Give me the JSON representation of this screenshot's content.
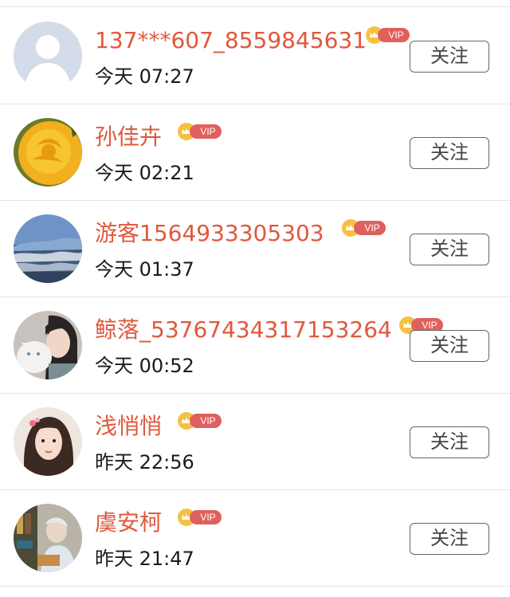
{
  "follow_list": {
    "follow_label": "关注",
    "vip_label": "VIP",
    "items": [
      {
        "name": "137***607_8559845631",
        "time": "今天 07:27",
        "avatar": "default-person-avatar"
      },
      {
        "name": "孙佳卉",
        "time": "今天 02:21",
        "avatar": "yellow-flower-avatar"
      },
      {
        "name": "游客1564933305303",
        "time": "今天 01:37",
        "avatar": "mountain-landscape-avatar"
      },
      {
        "name": "鲸落_53767434317153264",
        "time": "今天 00:52",
        "avatar": "girl-with-cat-avatar"
      },
      {
        "name": "浅悄悄",
        "time": "昨天 22:56",
        "avatar": "woman-portrait-avatar"
      },
      {
        "name": "虞安柯",
        "time": "昨天 21:47",
        "avatar": "illustration-avatar"
      }
    ]
  },
  "colors": {
    "name_text": "#e0583b",
    "vip_badge": "#e0605e",
    "crown": "#f2b01e",
    "divider": "#e4e4e4",
    "button_border": "#666666"
  }
}
